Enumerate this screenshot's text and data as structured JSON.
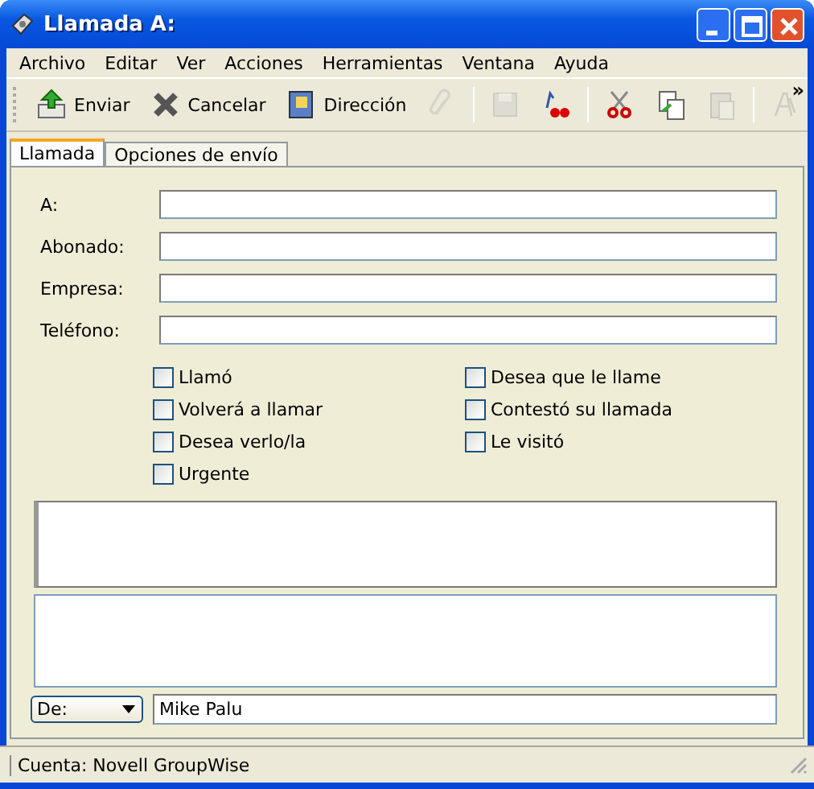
{
  "window": {
    "title": "Llamada A:"
  },
  "menu": [
    "Archivo",
    "Editar",
    "Ver",
    "Acciones",
    "Herramientas",
    "Ventana",
    "Ayuda"
  ],
  "toolbar": [
    {
      "kind": "button",
      "label": "Enviar",
      "disabled": false
    },
    {
      "kind": "button",
      "label": "Cancelar",
      "disabled": false
    },
    {
      "kind": "button",
      "label": "Dirección",
      "disabled": false
    },
    {
      "kind": "button",
      "disabled": true
    },
    {
      "kind": "separator"
    },
    {
      "kind": "button",
      "disabled": true
    },
    {
      "kind": "button",
      "disabled": false
    },
    {
      "kind": "separator"
    },
    {
      "kind": "button",
      "disabled": false
    },
    {
      "kind": "button",
      "disabled": false
    },
    {
      "kind": "button",
      "disabled": true
    },
    {
      "kind": "separator"
    },
    {
      "kind": "button",
      "disabled": true
    }
  ],
  "toolbar_overflow": "»",
  "tabs": [
    {
      "label": "Llamada",
      "selected": true
    },
    {
      "label": "Opciones de envío",
      "selected": false
    }
  ],
  "fields": [
    {
      "label": "A:"
    },
    {
      "label": "Abonado:"
    },
    {
      "label": "Empresa:"
    },
    {
      "label": "Teléfono:"
    }
  ],
  "checkboxes_left": [
    {
      "label": "Llamó",
      "checked": false
    },
    {
      "label": "Volverá a llamar",
      "checked": false
    },
    {
      "label": "Desea verlo/la",
      "checked": false
    },
    {
      "label": "Urgente",
      "checked": false
    }
  ],
  "checkboxes_right": [
    {
      "label": "Desea que le llame",
      "checked": false
    },
    {
      "label": "Contestó su llamada",
      "checked": false
    },
    {
      "label": "Le visitó",
      "checked": false
    }
  ],
  "from": {
    "dropdown": "De:",
    "value": "Mike Palu"
  },
  "status_bar": "Cuenta: Novell GroupWise"
}
